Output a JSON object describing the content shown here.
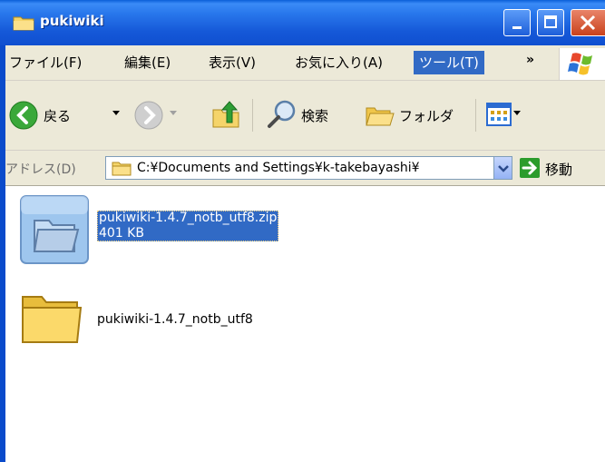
{
  "window": {
    "title": "pukiwiki"
  },
  "menu": {
    "items": [
      "ファイル(F)",
      "編集(E)",
      "表示(V)",
      "お気に入り(A)",
      "ツール(T)"
    ],
    "overflow": "»"
  },
  "toolbar": {
    "back_label": "戻る",
    "search_label": "検索",
    "folders_label": "フォルダ"
  },
  "address": {
    "label": "アドレス(D)",
    "path": "C:¥Documents and Settings¥k-takebayashi¥",
    "go_label": "移動"
  },
  "files": [
    {
      "name": "pukiwiki-1.4.7_notb_utf8.zip",
      "size": "401 KB",
      "type": "zip",
      "selected": true
    },
    {
      "name": "pukiwiki-1.4.7_notb_utf8",
      "type": "folder",
      "selected": false
    }
  ],
  "colors": {
    "titlebar": "#0f4fd0",
    "selection": "#316ac5",
    "chrome": "#ece9d8"
  }
}
